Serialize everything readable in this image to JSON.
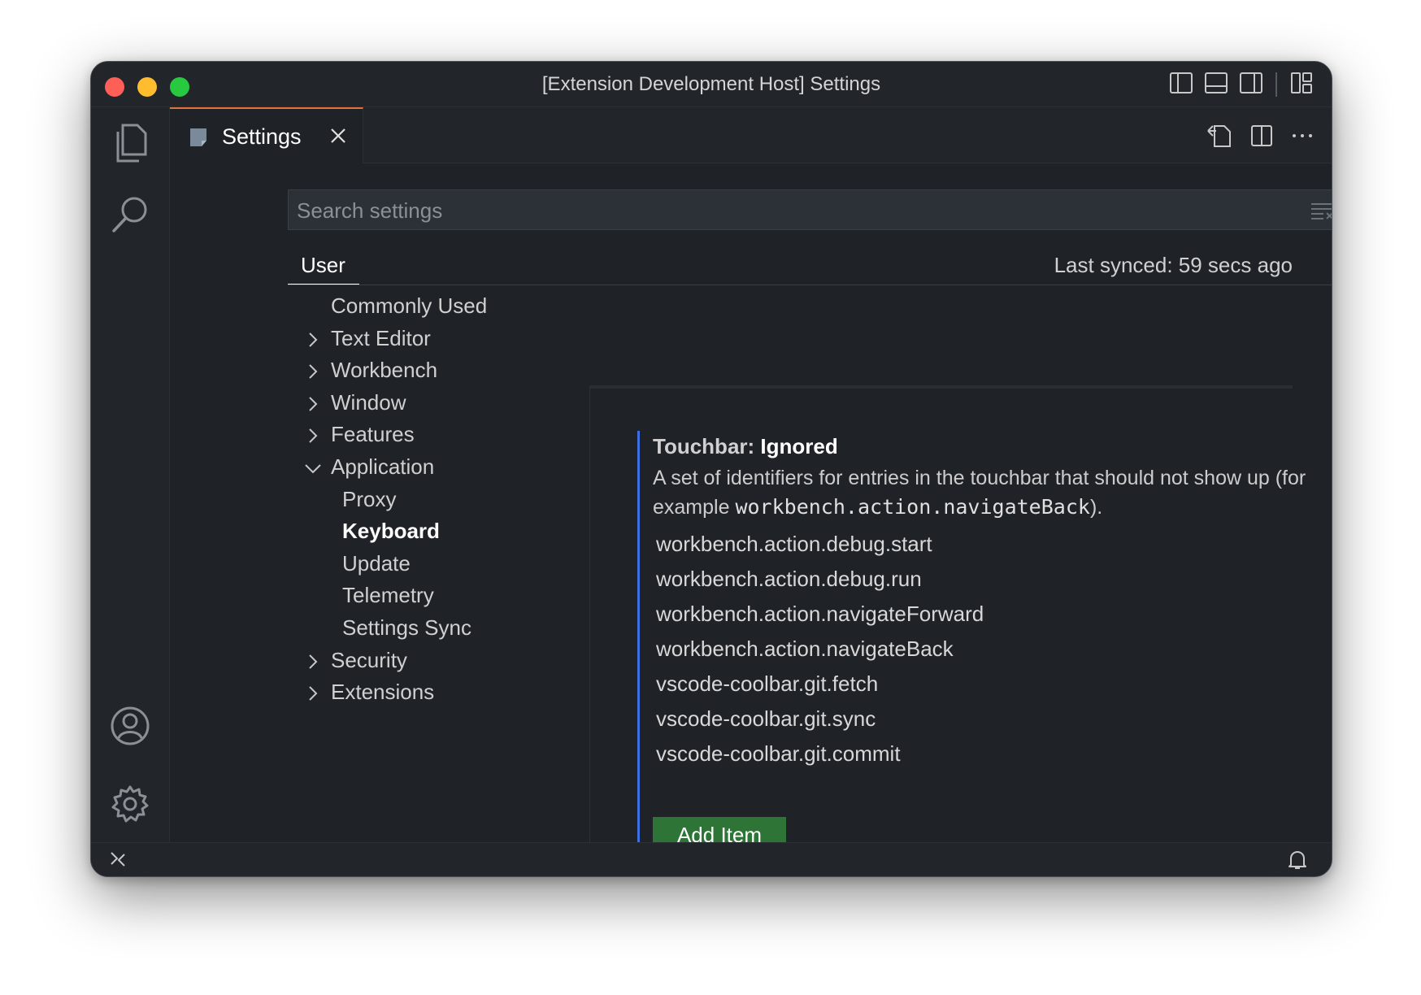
{
  "window": {
    "title": "[Extension Development Host] Settings"
  },
  "tabs": [
    {
      "label": "Settings"
    }
  ],
  "search": {
    "placeholder": "Search settings",
    "value": ""
  },
  "scope": {
    "tab_label": "User",
    "last_synced": "Last synced: 59 secs ago"
  },
  "toc": [
    {
      "label": "Commonly Used",
      "chevron": "none"
    },
    {
      "label": "Text Editor",
      "chevron": "right"
    },
    {
      "label": "Workbench",
      "chevron": "right"
    },
    {
      "label": "Window",
      "chevron": "right"
    },
    {
      "label": "Features",
      "chevron": "right"
    },
    {
      "label": "Application",
      "chevron": "down"
    },
    {
      "label": "Proxy",
      "chevron": "none",
      "child": true
    },
    {
      "label": "Keyboard",
      "chevron": "none",
      "child": true,
      "selected": true
    },
    {
      "label": "Update",
      "chevron": "none",
      "child": true
    },
    {
      "label": "Telemetry",
      "chevron": "none",
      "child": true
    },
    {
      "label": "Settings Sync",
      "chevron": "none",
      "child": true
    },
    {
      "label": "Security",
      "chevron": "right"
    },
    {
      "label": "Extensions",
      "chevron": "right"
    }
  ],
  "setting": {
    "category": "Touchbar: ",
    "name": "Ignored",
    "description_prefix": "A set of identifiers for entries in the touchbar that should not show up (for example ",
    "description_code": "workbench.action.navigateBack",
    "description_suffix": ").",
    "items": [
      "workbench.action.debug.start",
      "workbench.action.debug.run",
      "workbench.action.navigateForward",
      "workbench.action.navigateBack",
      "vscode-coolbar.git.fetch",
      "vscode-coolbar.git.sync",
      "vscode-coolbar.git.commit"
    ],
    "add_button_label": "Add Item"
  },
  "colors": {
    "accent_tab_border": "#e0733c",
    "setting_focus_bar": "#3d6fe0",
    "add_button": "#2d7436",
    "window_bg": "#1f2227"
  },
  "icons": {
    "activity_bar": [
      "files-icon",
      "search-icon",
      "account-icon",
      "settings-gear-icon"
    ],
    "title_bar": [
      "toggle-primary-sidebar-icon",
      "toggle-panel-icon",
      "toggle-secondary-sidebar-icon",
      "customize-layout-icon"
    ],
    "editor_actions": [
      "open-settings-json-icon",
      "split-editor-icon",
      "more-actions-icon"
    ],
    "status_bar": [
      "remote-icon",
      "notifications-bell-icon"
    ]
  }
}
